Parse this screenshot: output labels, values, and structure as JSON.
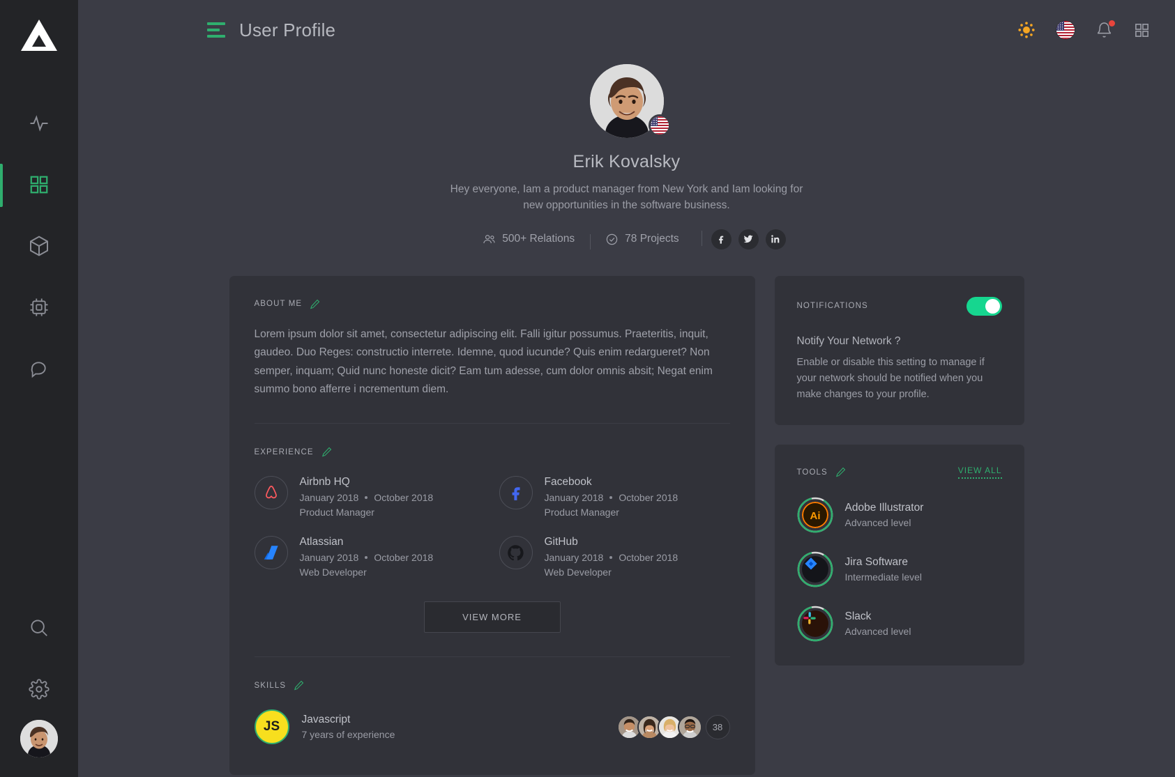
{
  "app": {
    "logo_icon": "triangle-logo"
  },
  "sidebar": {
    "items": [
      {
        "id": "activity",
        "icon": "activity-pulse-icon",
        "active": false
      },
      {
        "id": "dashboard",
        "icon": "grid-squares-icon",
        "active": true
      },
      {
        "id": "packages",
        "icon": "cube-box-icon",
        "active": false
      },
      {
        "id": "hardware",
        "icon": "cpu-chip-icon",
        "active": false
      },
      {
        "id": "messages",
        "icon": "chat-bubble-icon",
        "active": false
      }
    ],
    "bottom_items": [
      {
        "id": "search",
        "icon": "search-icon"
      },
      {
        "id": "settings",
        "icon": "gear-icon"
      },
      {
        "id": "profile",
        "icon": "user-avatar"
      }
    ]
  },
  "header": {
    "menu_icon": "hamburger-menu-icon",
    "title": "User Profile",
    "theme_icon": "sun-icon",
    "language_icon": "us-flag-icon",
    "notifications_icon": "bell-icon",
    "has_notification_dot": true,
    "apps_icon": "grid-apps-icon"
  },
  "profile": {
    "avatar_icon": "profile-photo",
    "country_flag": "us-flag-icon",
    "name": "Erik Kovalsky",
    "bio": "Hey everyone,  Iam a product manager from New York and Iam looking for new opportunities in the software business.",
    "stats": [
      {
        "icon": "people-icon",
        "label": "500+ Relations"
      },
      {
        "icon": "check-circle-icon",
        "label": "78 Projects"
      }
    ],
    "socials": [
      {
        "icon": "facebook-icon",
        "label": "f"
      },
      {
        "icon": "twitter-icon",
        "label": "t"
      },
      {
        "icon": "linkedin-icon",
        "label": "in"
      }
    ]
  },
  "about": {
    "heading": "ABOUT ME",
    "edit_icon": "pencil-edit-icon",
    "text": "Lorem ipsum dolor sit amet, consectetur adipiscing elit. Falli igitur possumus. Praeteritis, inquit, gaudeo. Duo Reges: constructio interrete. Idemne, quod iucunde? Quis enim redargueret? Non semper, inquam; Quid nunc honeste dicit? Eam tum adesse, cum dolor omnis absit; Negat enim summo bono afferre i ncrementum diem."
  },
  "experience": {
    "heading": "EXPERIENCE",
    "edit_icon": "pencil-edit-icon",
    "items": [
      {
        "logo": "airbnb-icon",
        "company": "Airbnb HQ",
        "start": "January 2018",
        "end": "October 2018",
        "role": "Product Manager"
      },
      {
        "logo": "facebook-icon",
        "company": "Facebook",
        "start": "January 2018",
        "end": "October 2018",
        "role": "Product Manager"
      },
      {
        "logo": "atlassian-icon",
        "company": "Atlassian",
        "start": "January 2018",
        "end": "October 2018",
        "role": "Web Developer"
      },
      {
        "logo": "github-icon",
        "company": "GitHub",
        "start": "January 2018",
        "end": "October 2018",
        "role": "Web Developer"
      }
    ],
    "view_more_label": "VIEW MORE"
  },
  "skills": {
    "heading": "SKILLS",
    "edit_icon": "pencil-edit-icon",
    "items": [
      {
        "badge": "javascript-icon",
        "badge_text": "JS",
        "name": "Javascript",
        "experience": "7 years of experience",
        "endorsers": [
          "person-avatar-1",
          "person-avatar-2",
          "person-avatar-3",
          "person-avatar-4"
        ],
        "extra_count": "38"
      }
    ]
  },
  "notifications_panel": {
    "heading": "NOTIFICATIONS",
    "toggle_on": true,
    "question": "Notify Your Network ?",
    "description": "Enable or disable this setting to manage if your network should be notified when you make changes to your profile."
  },
  "tools_panel": {
    "heading": "TOOLS",
    "edit_icon": "pencil-edit-icon",
    "view_all_label": "VIEW ALL",
    "items": [
      {
        "icon": "adobe-illustrator-icon",
        "name": "Adobe Illustrator",
        "level": "Advanced level",
        "progress": 88
      },
      {
        "icon": "jira-software-icon",
        "name": "Jira Software",
        "level": "Intermediate level",
        "progress": 88
      },
      {
        "icon": "slack-icon",
        "name": "Slack",
        "level": "Advanced level",
        "progress": 88
      }
    ]
  },
  "colors": {
    "page_bg": "#3b3c45",
    "rail_bg": "#232427",
    "card_bg": "#313239",
    "accent_green": "#2fae6e",
    "toggle_green": "#16d68f",
    "text_primary": "#c0c2c9",
    "text_muted": "#9a9ca5",
    "notification_red": "#e8453c",
    "sun_orange": "#f5a623"
  }
}
